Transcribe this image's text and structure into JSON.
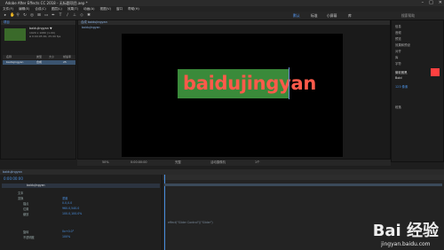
{
  "app": {
    "title": "Adobe After Effects CC 2018 - 无标题项目.aep *",
    "menu": [
      "文件(F)",
      "编辑(E)",
      "合成(C)",
      "图层(L)",
      "效果(T)",
      "动画(A)",
      "视图(V)",
      "窗口",
      "帮助(H)"
    ]
  },
  "toolbar": {
    "workspaces": [
      "默认",
      "标准",
      "小屏幕",
      "库"
    ],
    "active_workspace": "默认",
    "search_placeholder": "搜索帮助"
  },
  "project": {
    "tab": "项目",
    "comp_name": "baidujingyan ▼",
    "comp_info": "1920 x 1080 (1.00)",
    "comp_info2": "Δ 0:00:05:00, 25.00 fps",
    "columns": [
      "名称",
      "类型",
      "大小",
      "帧速率"
    ],
    "items": [
      {
        "name": "baidujingyan",
        "type": "合成",
        "fps": "25"
      }
    ]
  },
  "composition": {
    "tab": "合成 baidujingyan",
    "breadcrumb": "baidujingyan",
    "text": "baidujingyan",
    "zoom": "50%",
    "timecode": "0:00:00:00",
    "quality": "完整",
    "camera": "活动摄像机",
    "views": "1个"
  },
  "right_panel": {
    "items": [
      "信息",
      "音频",
      "预览",
      "效果和预设",
      "对齐",
      "库",
      "字符",
      "段落"
    ],
    "font": "微软雅黑",
    "font_style": "Bold",
    "font_size": "123 像素",
    "accent_color": "#ff4040"
  },
  "timeline": {
    "tab": "baidujingyan",
    "timecode": "0:00:00:00",
    "layer_name": "baidujingyan",
    "props": [
      {
        "label": "文本",
        "value": ""
      },
      {
        "label": "变换",
        "value": "重置"
      },
      {
        "label": "锚点",
        "value": "0.0,0.0"
      },
      {
        "label": "位置",
        "value": "960.0,540.0"
      },
      {
        "label": "缩放",
        "value": "100.0,100.0%"
      },
      {
        "label": "旋转",
        "value": "0x+0.0°"
      },
      {
        "label": "不透明度",
        "value": "100%"
      }
    ],
    "expression": "effect(\"Slider Control\")(\"Slider\")"
  },
  "watermark": {
    "logo": "Bai  经验",
    "url": "jingyan.baidu.com"
  }
}
